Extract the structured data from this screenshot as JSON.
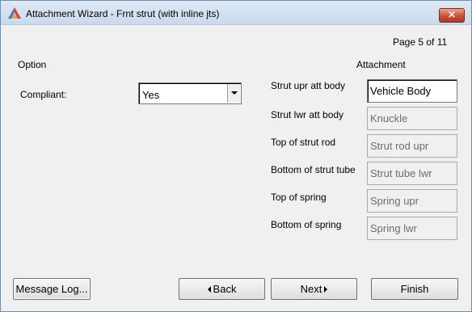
{
  "window": {
    "title": "Attachment Wizard - Frnt strut (with inline jts)",
    "close_label": "×",
    "accent_color": "#c94f35",
    "icon": "app-logo-icon"
  },
  "header": {
    "page_indicator": "Page  5 of 11",
    "option_header": "Option",
    "attachment_header": "Attachment"
  },
  "options": {
    "compliant_label": "Compliant:",
    "compliant_value": "Yes"
  },
  "attachments": [
    {
      "label": "Strut upr att body",
      "value": "Vehicle Body"
    },
    {
      "label": "Strut lwr att body",
      "value": "Knuckle"
    },
    {
      "label": "Top of strut rod",
      "value": "Strut rod upr"
    },
    {
      "label": "Bottom of strut tube",
      "value": "Strut tube lwr"
    },
    {
      "label": "Top of spring",
      "value": "Spring upr"
    },
    {
      "label": "Bottom of spring",
      "value": "Spring lwr"
    }
  ],
  "buttons": {
    "message_log": "Message Log...",
    "back": "Back",
    "next": "Next",
    "finish": "Finish"
  }
}
